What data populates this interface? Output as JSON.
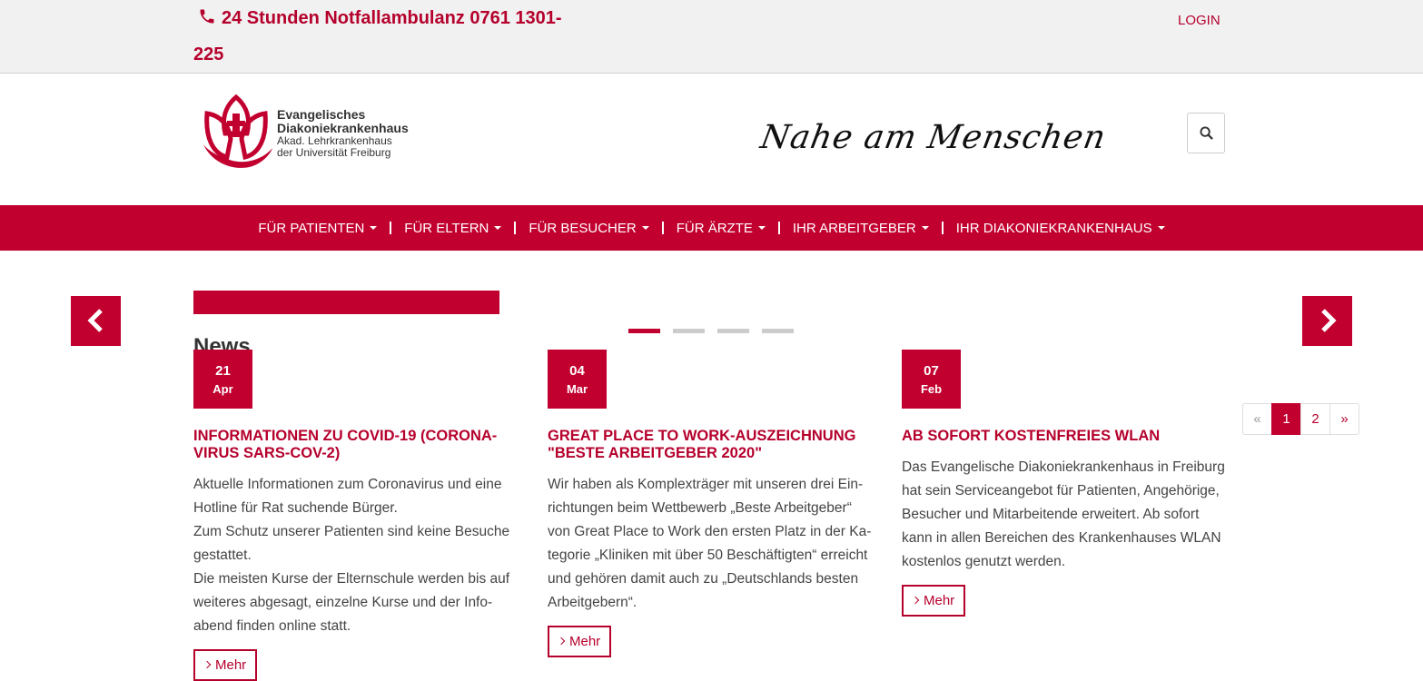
{
  "topbar": {
    "emergency_text": "24 Stunden Notfallambulanz 0761 1301-225",
    "login_label": "LOGIN"
  },
  "header": {
    "logo_line1": "Evangelisches",
    "logo_line2": "Diakoniekrankenhaus",
    "logo_line3": "Akad. Lehrkrankenhaus",
    "logo_line4": "der Universität Freiburg",
    "slogan": "Nahe am Menschen"
  },
  "nav": {
    "items": [
      {
        "label": "FÜR PATIENTEN"
      },
      {
        "label": "FÜR ELTERN"
      },
      {
        "label": "FÜR BESUCHER"
      },
      {
        "label": "FÜR ÄRZTE"
      },
      {
        "label": "IHR ARBEITGEBER"
      },
      {
        "label": "IHR DIAKONIEKRANKENHAUS"
      }
    ]
  },
  "news": {
    "title": "News",
    "cards": [
      {
        "day": "21",
        "month": "Apr",
        "title": "Informationen zu COVID-19 (Corona-Virus SARS-CoV-2)",
        "paragraphs": [
          "Aktuelle Informationen zum Coronavirus und eine Hotline für Rat suchende Bürger.",
          "Zum Schutz unserer Patienten sind keine Besuche gestattet.",
          "Die meisten Kurse der Elternschule werden bis auf weiteres abgesagt, einzelne Kurse und der Info-abend finden online statt."
        ],
        "more_label": "Mehr"
      },
      {
        "day": "04",
        "month": "Mar",
        "title": "Great Place to Work-Auszeichnung \"Beste Arbeitgeber 2020\"",
        "paragraphs": [
          "Wir haben als Komplexträger mit unseren drei Ein-richtungen beim Wettbewerb „Beste Arbeitgeber“ von Great Place to Work den ersten Platz in der Ka-tegorie „Kliniken mit über 50 Beschäftigten“ erreicht und gehören damit auch zu „Deutschlands besten Arbeitgebern“."
        ],
        "more_label": "Mehr"
      },
      {
        "day": "07",
        "month": "Feb",
        "title": "Ab sofort kostenfreies WLAN",
        "paragraphs": [
          "Das Evangelische Diakoniekrankenhaus in Freiburg hat sein Serviceangebot für Patienten, Angehörige, Besucher und Mitarbeitende erweitert. Ab sofort kann in allen Bereichen des Krankenhauses WLAN kostenlos genutzt werden."
        ],
        "more_label": "Mehr"
      }
    ]
  },
  "pagination": {
    "prev": "«",
    "pages": [
      "1",
      "2"
    ],
    "next": "»",
    "active_page": "1"
  },
  "colors": {
    "brand_red": "#c2002f",
    "topbar_bg": "#f1f1f1"
  }
}
